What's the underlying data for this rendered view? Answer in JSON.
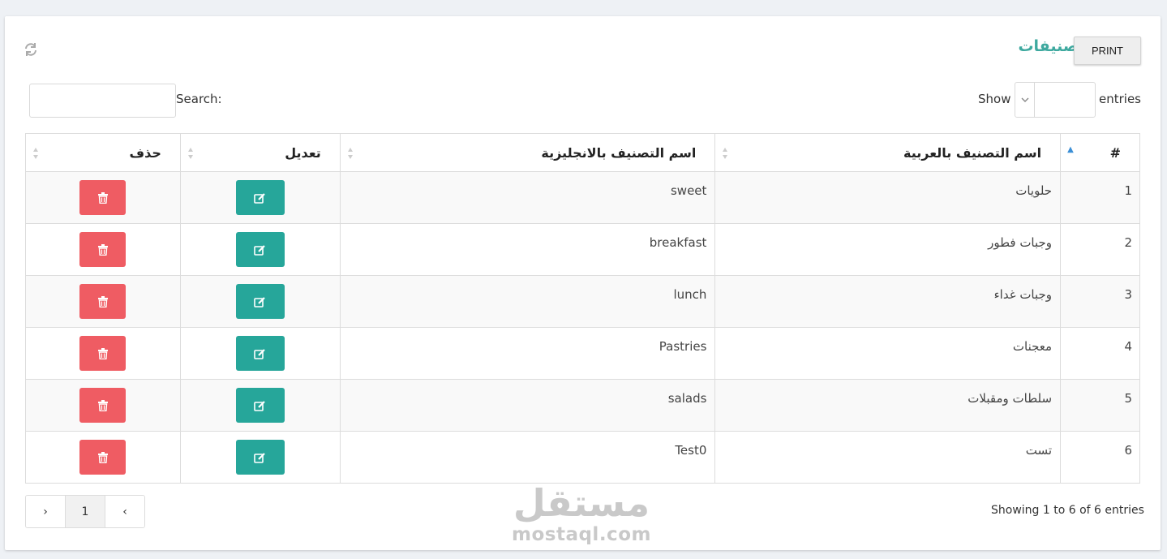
{
  "header": {
    "title": "التصنيفات",
    "print_label": "PRINT"
  },
  "controls": {
    "show_label": "Show",
    "entries_label": "entries",
    "length_value": "",
    "search_label": "Search:",
    "search_value": ""
  },
  "table": {
    "columns": [
      "#",
      "اسم التصنيف بالعربية",
      "اسم التصنيف بالانجليزية",
      "تعديل",
      "حذف"
    ],
    "rows": [
      {
        "num": "1",
        "ar": "حلويات",
        "en": "sweet"
      },
      {
        "num": "2",
        "ar": "وجبات فطور",
        "en": "breakfast"
      },
      {
        "num": "3",
        "ar": "وجبات غداء",
        "en": "lunch"
      },
      {
        "num": "4",
        "ar": "معجنات",
        "en": "Pastries"
      },
      {
        "num": "5",
        "ar": "سلطات ومقبلات",
        "en": "salads"
      },
      {
        "num": "6",
        "ar": "تست",
        "en": "Test0"
      }
    ]
  },
  "footer": {
    "info": "Showing 1 to 6 of 6 entries",
    "prev_symbol": "‹",
    "next_symbol": "›",
    "current_page": "1"
  },
  "watermark": {
    "ar": "مستقل",
    "en": "mostaql.com"
  },
  "colors": {
    "accent": "#3ea99f",
    "edit": "#26a69a",
    "delete": "#ef5c63"
  }
}
